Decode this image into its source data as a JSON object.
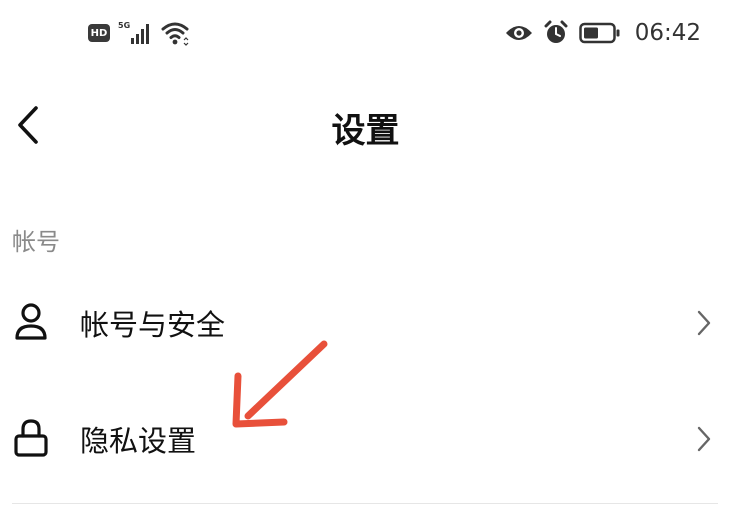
{
  "status_bar": {
    "hd_badge": "HD",
    "network_label": "5G",
    "time": "06:42",
    "icons": [
      "signal-icon",
      "wifi-icon",
      "eye-icon",
      "alarm-icon",
      "battery-icon"
    ]
  },
  "header": {
    "title": "设置",
    "back_icon": "chevron-left-icon"
  },
  "sections": [
    {
      "title": "帐号",
      "items": [
        {
          "label": "帐号与安全",
          "icon": "user-icon"
        },
        {
          "label": "隐私设置",
          "icon": "lock-icon"
        }
      ]
    }
  ],
  "annotation": {
    "arrow_color": "#e8503a",
    "arrow_icon": "arrow-annotation-icon"
  }
}
